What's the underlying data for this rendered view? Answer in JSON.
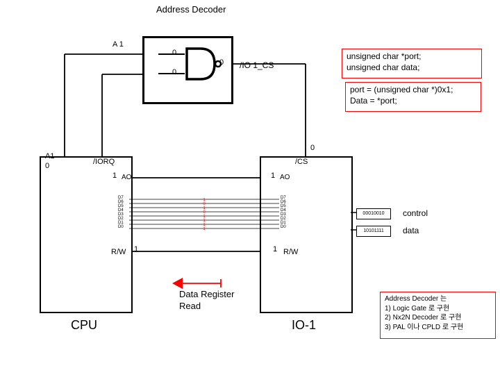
{
  "title": "Address Decoder",
  "and_gate": {
    "a1_label": "A 1",
    "in_top_val": "0",
    "in_bot_val": "0",
    "out_val": "0",
    "out_label": "/IO 1_CS"
  },
  "code1": {
    "line1": "unsigned char *port;",
    "line2": "unsigned char data;"
  },
  "code2": {
    "line1": "port = (unsigned char *)0x1;",
    "line2": "Data = *port;"
  },
  "cpu": {
    "a1_lines": "A1\n0",
    "iorq": "/IORQ",
    "ao_val": "1",
    "ao_label": "AO",
    "rw_label": "R/W",
    "rw_val": "1",
    "bus": "D7\nD6\nD5\nD4\nD3\nD2\nD1\nD0",
    "name": "CPU"
  },
  "io": {
    "cs_label": "/CS",
    "cs_top_val": "0",
    "ao_val": "1",
    "ao_label": "AO",
    "rw_label": "R/W",
    "rw_val": "1",
    "bus": "D7\nD6\nD5\nD4\nD3\nD2\nD1\nD0",
    "name": "IO-1"
  },
  "bits": {
    "control": "00010010",
    "control_label": "control",
    "data": "10101111",
    "data_label": "data"
  },
  "data_reg": "Data Register\nRead",
  "addr_decoder_notes": {
    "title": "Address Decoder 는",
    "item1": "1)  Logic Gate 로 구현",
    "item2": "2)  Nx2N Decoder 로 구현",
    "item3": "3)  PAL 이나 CPLD 로 구현"
  }
}
